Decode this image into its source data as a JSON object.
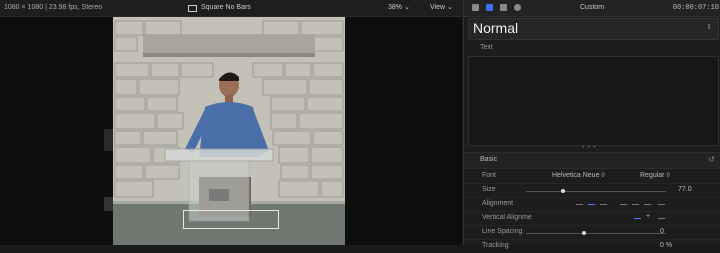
{
  "viewer": {
    "format": "1080 × 1080 | 23.98 fps, Stereo",
    "aspect_label": "Square No Bars",
    "zoom": "38%",
    "view_menu": "View"
  },
  "inspector": {
    "title": "Custom",
    "timecode": "00:00:07:10",
    "preset": "Normal",
    "text_label": "Text",
    "section": "Basic",
    "rows": {
      "font": {
        "label": "Font",
        "family": "Helvetica Neue ◊",
        "style": "Regular ◊"
      },
      "size": {
        "label": "Size",
        "value": "77.0"
      },
      "alignment": {
        "label": "Alignment"
      },
      "vertical_alignment": {
        "label": "Vertical Alignme"
      },
      "line_spacing": {
        "label": "Line Spacing",
        "value": "0"
      },
      "tracking": {
        "label": "Tracking",
        "value": "0 %"
      }
    }
  },
  "colors": {
    "accent": "#3e6ff7"
  }
}
